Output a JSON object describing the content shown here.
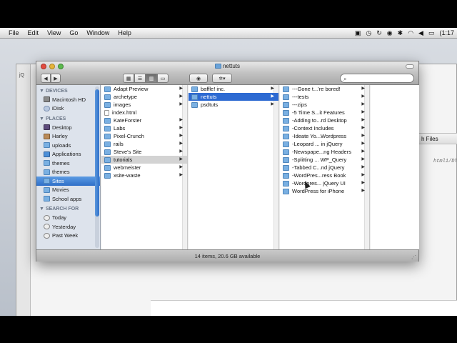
{
  "menubar": {
    "apple": "",
    "items": [
      "File",
      "Edit",
      "View",
      "Go",
      "Window",
      "Help"
    ],
    "clock": "(1:17"
  },
  "background_window": {
    "tab_label": "h Files",
    "code_text": "html1/DTD/",
    "corner_label": "jQ"
  },
  "finder": {
    "title": "nettuts",
    "status": "14 items, 20.6 GB available",
    "search_placeholder": "",
    "sidebar": {
      "sections": [
        {
          "header": "DEVICES",
          "items": [
            {
              "label": "Macintosh HD",
              "icon": "disk-icon"
            },
            {
              "label": "iDisk",
              "icon": "cloud-icon"
            }
          ]
        },
        {
          "header": "PLACES",
          "items": [
            {
              "label": "Desktop",
              "icon": "desktop-icon"
            },
            {
              "label": "Harley",
              "icon": "home-icon"
            },
            {
              "label": "uploads",
              "icon": "folder-icon"
            },
            {
              "label": "Applications",
              "icon": "applications-icon"
            },
            {
              "label": "themes",
              "icon": "folder-icon"
            },
            {
              "label": "themes",
              "icon": "folder-icon"
            },
            {
              "label": "Sites",
              "icon": "folder-icon",
              "selected": true
            },
            {
              "label": "Movies",
              "icon": "folder-icon"
            },
            {
              "label": "School apps",
              "icon": "folder-icon"
            }
          ]
        },
        {
          "header": "SEARCH FOR",
          "items": [
            {
              "label": "Today",
              "icon": "clock-icon"
            },
            {
              "label": "Yesterday",
              "icon": "clock-icon"
            },
            {
              "label": "Past Week",
              "icon": "clock-icon"
            }
          ]
        }
      ]
    },
    "columns": [
      [
        {
          "label": "Adapt Preview",
          "icon": "folder",
          "arrow": true
        },
        {
          "label": "archetype",
          "icon": "folder",
          "arrow": true
        },
        {
          "label": "images",
          "icon": "folder",
          "arrow": true
        },
        {
          "label": "index.html",
          "icon": "file",
          "arrow": false
        },
        {
          "label": "KateForster",
          "icon": "folder",
          "arrow": true
        },
        {
          "label": "Labs",
          "icon": "folder",
          "arrow": true
        },
        {
          "label": "Pixel-Crunch",
          "icon": "folder",
          "arrow": true
        },
        {
          "label": "rails",
          "icon": "folder",
          "arrow": true
        },
        {
          "label": "Steve's Site",
          "icon": "folder",
          "arrow": true
        },
        {
          "label": "tutorials",
          "icon": "folder",
          "arrow": true,
          "state": "hl"
        },
        {
          "label": "webmeister",
          "icon": "folder",
          "arrow": true
        },
        {
          "label": "xsite-waste",
          "icon": "folder",
          "arrow": true
        }
      ],
      [
        {
          "label": "baffle! inc.",
          "icon": "folder",
          "arrow": true
        },
        {
          "label": "nettuts",
          "icon": "folder",
          "arrow": true,
          "state": "sel"
        },
        {
          "label": "psdtuts",
          "icon": "folder",
          "arrow": true
        }
      ],
      [
        {
          "label": "---Gone t...'re bored!",
          "icon": "folder",
          "arrow": true
        },
        {
          "label": "---tests",
          "icon": "folder",
          "arrow": true
        },
        {
          "label": "---zips",
          "icon": "folder",
          "arrow": true
        },
        {
          "label": "-5 Time S...it Features",
          "icon": "folder",
          "arrow": true
        },
        {
          "label": "-Adding to...rd Desktop",
          "icon": "folder",
          "arrow": true
        },
        {
          "label": "-Context Includes",
          "icon": "folder",
          "arrow": true
        },
        {
          "label": "-Ideate Yo...Wordpress",
          "icon": "folder",
          "arrow": true
        },
        {
          "label": "-Leopard ... in jQuery",
          "icon": "folder",
          "arrow": true
        },
        {
          "label": "-Newspape...ng Headers",
          "icon": "folder",
          "arrow": true
        },
        {
          "label": "-Splitting ... WP_Query",
          "icon": "folder",
          "arrow": true
        },
        {
          "label": "-Tabbed C...nd jQuery",
          "icon": "folder",
          "arrow": true
        },
        {
          "label": "-WordPres...ress Book",
          "icon": "folder",
          "arrow": true
        },
        {
          "label": "-Wordpres... jQuery UI",
          "icon": "folder",
          "arrow": true
        },
        {
          "label": "WordPress for iPhone",
          "icon": "folder",
          "arrow": true
        }
      ]
    ]
  }
}
